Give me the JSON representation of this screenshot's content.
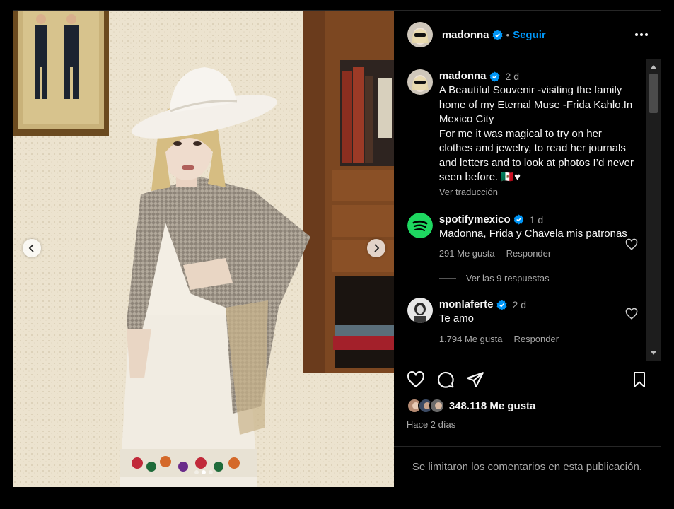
{
  "post": {
    "author": "madonna",
    "follow_label": "Seguir",
    "more_icon": "more-horizontal-icon"
  },
  "caption": {
    "author": "madonna",
    "time": "2 d",
    "text": "A Beautiful Souvenir -visiting the family home of my Eternal Muse -Frida Kahlo.In Mexico City\nFor me it was magical to try on her clothes and jewelry, to read her journals and letters and to look at photos I’d never seen before. 🇲🇽♥",
    "translate_label": "Ver traducción"
  },
  "comments": [
    {
      "author": "spotifymexico",
      "time": "1 d",
      "text": "Madonna, Frida y Chavela mis patronas",
      "likes": "291 Me gusta",
      "reply_label": "Responder",
      "view_replies": "Ver las 9 respuestas"
    },
    {
      "author": "monlaferte",
      "time": "2 d",
      "text": "Te amo",
      "likes": "1.794 Me gusta",
      "reply_label": "Responder"
    }
  ],
  "actions": {
    "likes_count": "348.118 Me gusta",
    "time_ago": "Hace 2 días",
    "icons": [
      "heart-icon",
      "comment-icon",
      "share-icon",
      "bookmark-icon"
    ]
  },
  "footer": {
    "comments_closed": "Se limitaron los comentarios en esta publicación."
  },
  "colors": {
    "accent": "#0095f6",
    "background": "#000000",
    "secondary_text": "#a8a8a8",
    "spotify": "#1ed760"
  },
  "carousel": {
    "current": 2,
    "total": 3
  }
}
